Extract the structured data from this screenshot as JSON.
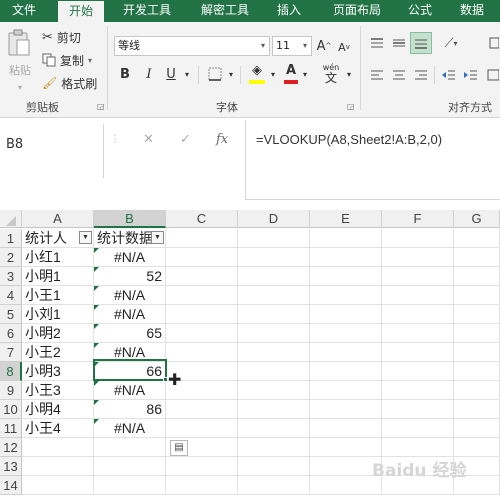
{
  "tabs": [
    "文件",
    "开始",
    "开发工具",
    "解密工具",
    "插入",
    "页面布局",
    "公式",
    "数据"
  ],
  "ribbon": {
    "clipboard": {
      "paste": "粘贴",
      "cut": "剪切",
      "copy": "复制",
      "format_painter": "格式刷",
      "group_label": "剪贴板"
    },
    "font": {
      "family": "等线",
      "size": "11",
      "grow": "A",
      "shrink": "A",
      "bold": "B",
      "italic": "I",
      "underline": "U",
      "phonetic": "wén",
      "group_label": "字体"
    },
    "alignment": {
      "group_label": "对齐方式"
    }
  },
  "formula_bar": {
    "name_box": "B8",
    "cancel": "✕",
    "enter": "✓",
    "fx": "fx",
    "formula": "=VLOOKUP(A8,Sheet2!A:B,2,0)"
  },
  "columns": [
    "A",
    "B",
    "C",
    "D",
    "E",
    "F",
    "G"
  ],
  "rows": [
    "1",
    "2",
    "3",
    "4",
    "5",
    "6",
    "7",
    "8",
    "9",
    "10",
    "11",
    "12",
    "13",
    "14"
  ],
  "table": {
    "header": [
      "统计人",
      "统计数据"
    ],
    "data": [
      [
        "小红1",
        "#N/A"
      ],
      [
        "小明1",
        "52"
      ],
      [
        "小王1",
        "#N/A"
      ],
      [
        "小刘1",
        "#N/A"
      ],
      [
        "小明2",
        "65"
      ],
      [
        "小王2",
        "#N/A"
      ],
      [
        "小明3",
        "66"
      ],
      [
        "小王3",
        "#N/A"
      ],
      [
        "小明4",
        "86"
      ],
      [
        "小王4",
        "#N/A"
      ]
    ]
  },
  "watermark": "Baidu 经验",
  "colors": {
    "accent": "#217346",
    "error_triangle": "#1e7145"
  }
}
